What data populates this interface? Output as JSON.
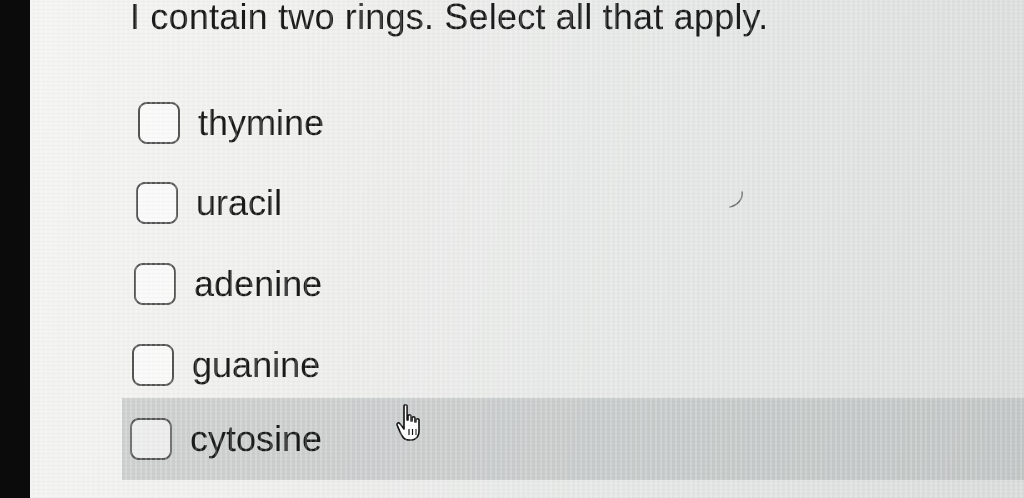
{
  "question": {
    "text": "I contain two rings. Select all that apply."
  },
  "options": [
    {
      "label": "thymine",
      "checked": false
    },
    {
      "label": "uracil",
      "checked": false
    },
    {
      "label": "adenine",
      "checked": false
    },
    {
      "label": "guanine",
      "checked": false
    },
    {
      "label": "cytosine",
      "checked": false,
      "hovered": true
    }
  ],
  "cursor": {
    "icon": "hand-pointer-icon"
  }
}
